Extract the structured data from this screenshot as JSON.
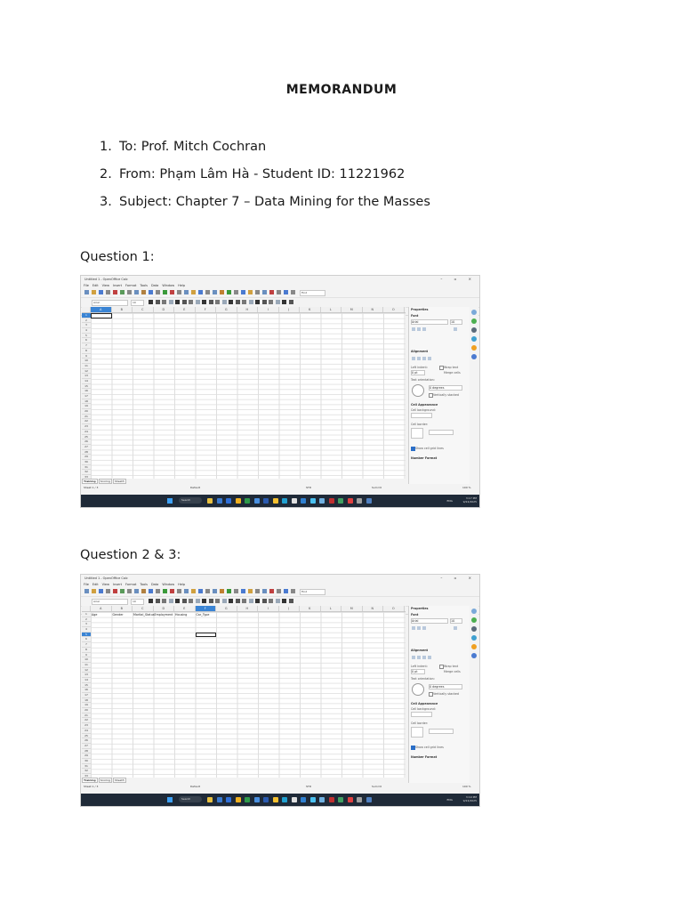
{
  "memo": {
    "title": "MEMORANDUM",
    "items": [
      {
        "num": "1.",
        "text": "To: Prof. Mitch Cochran"
      },
      {
        "num": "2.",
        "text": "From: Phạm Lâm Hà - Student ID: 11221962"
      },
      {
        "num": "3.",
        "text": "Subject: Chapter 7 – Data Mining for the Masses"
      }
    ]
  },
  "questions": [
    {
      "heading": "Question 1:"
    },
    {
      "heading": "Question 2 & 3:"
    }
  ],
  "calc": {
    "window_title": "Untitled 1 - OpenOffice Calc",
    "window_controls": "– ▫ ×",
    "menu": [
      "File",
      "Edit",
      "View",
      "Insert",
      "Format",
      "Tools",
      "Data",
      "Window",
      "Help"
    ],
    "font_name": "Arial",
    "font_size": "10",
    "find_placeholder": "Find",
    "fx": "f(x)",
    "columns": [
      "A",
      "B",
      "C",
      "D",
      "E",
      "F",
      "G",
      "H",
      "I",
      "J",
      "K",
      "L",
      "M",
      "N",
      "O",
      "P"
    ],
    "rows": [
      "1",
      "2",
      "3",
      "4",
      "5",
      "6",
      "7",
      "8",
      "9",
      "10",
      "11",
      "12",
      "13",
      "14",
      "15",
      "16",
      "17",
      "18",
      "19",
      "20",
      "21",
      "22",
      "23",
      "24",
      "25",
      "26",
      "27",
      "28",
      "29",
      "30",
      "31",
      "32",
      "33"
    ],
    "sheet_tabs": [
      "Training",
      "Scoring",
      "Sheet3"
    ],
    "status": {
      "sheet": "Sheet 1 / 3",
      "style": "Default",
      "mode": "STD",
      "sum": "Sum=0",
      "zoom": "100 %"
    },
    "sidebar": {
      "title": "Properties",
      "font_section": "Font",
      "font_name": "Arial",
      "font_size": "10",
      "alignment_section": "Alignment",
      "left_indent": "Left indent:",
      "indent_value": "0 pt",
      "wrap_text": "Wrap text",
      "merge_cells": "Merge cells",
      "text_orientation": "Text orientation:",
      "degrees": "0 degrees",
      "vertically_stacked": "Vertically stacked",
      "cell_appearance_section": "Cell Appearance",
      "cell_background": "Cell background:",
      "cell_border": "Cell border:",
      "show_gridlines": "Show cell grid lines",
      "number_format_section": "Number Format"
    },
    "taskbar": {
      "search": "Search",
      "lang": "ENG"
    },
    "shot1": {
      "name_box": "A1",
      "time": "3:17 PM",
      "date": "9/24/2025",
      "active_col": "A",
      "active_row": "1"
    },
    "shot2": {
      "name_box": "E5",
      "time": "3:19 PM",
      "date": "9/24/2025",
      "active_col": "F",
      "active_row": "5",
      "headers": [
        "Age",
        "Gender",
        "Marital_Status",
        "Employment",
        "Housing",
        "Car_Type"
      ]
    }
  },
  "colors": {
    "accent": "#3a84d4",
    "taskbar": "#1f2a38"
  }
}
